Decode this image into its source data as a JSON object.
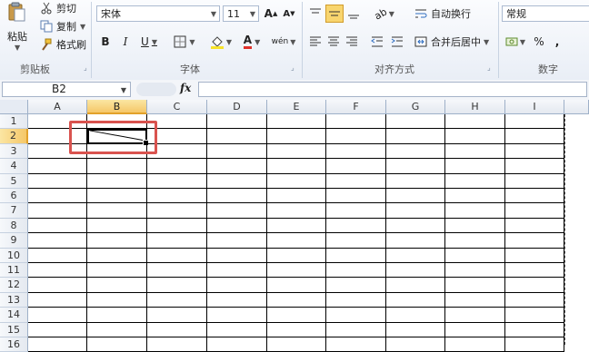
{
  "ribbon": {
    "clipboard": {
      "paste": "粘贴",
      "cut": "剪切",
      "copy": "复制",
      "format_painter": "格式刷",
      "group_label": "剪贴板"
    },
    "font": {
      "font_name": "宋体",
      "font_size": "11",
      "grow": "A",
      "shrink": "A",
      "bold": "B",
      "italic": "I",
      "underline": "U",
      "font_color_letter": "A",
      "phonetic": "wén",
      "group_label": "字体"
    },
    "alignment": {
      "wrap_text": "自动换行",
      "merge_center": "合并后居中",
      "group_label": "对齐方式"
    },
    "number": {
      "format": "常规",
      "percent": "%",
      "comma": ",",
      "group_label": "数字"
    }
  },
  "formula_bar": {
    "name_box": "B2",
    "fx": "fx",
    "value": ""
  },
  "columns": [
    "A",
    "B",
    "C",
    "D",
    "E",
    "F",
    "G",
    "H",
    "I"
  ],
  "rows": [
    "1",
    "2",
    "3",
    "4",
    "5",
    "6",
    "7",
    "8",
    "9",
    "10",
    "11",
    "12",
    "13",
    "14",
    "15",
    "16"
  ],
  "selected_cell": "B2",
  "colors": {
    "highlight": "#d9534f",
    "selected_header": "#f5c768"
  }
}
